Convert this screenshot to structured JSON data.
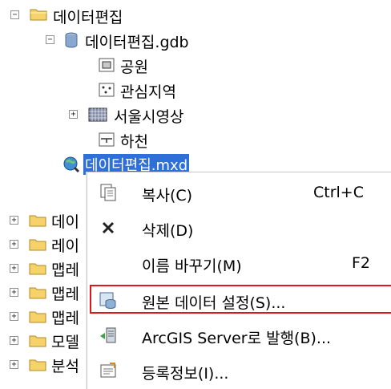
{
  "tree": {
    "root_label": "데이터편집",
    "gdb_label": "데이터편집.gdb",
    "children": [
      "공원",
      "관심지역",
      "서울시영상",
      "하천"
    ],
    "mxd_label": "데이터편집.mxd",
    "collapsed_partial": [
      "데이",
      "레이",
      "맵레",
      "맵레",
      "맵레",
      "모델",
      "분석"
    ]
  },
  "context_menu": {
    "items": [
      {
        "label": "복사(C)",
        "shortcut": "Ctrl+C",
        "icon": "copy-icon"
      },
      {
        "label": "삭제(D)",
        "shortcut": "",
        "icon": "delete-x-icon"
      },
      {
        "label": "이름 바꾸기(M)",
        "shortcut": "F2",
        "icon": ""
      },
      {
        "label": "원본 데이터 설정(S)...",
        "shortcut": "",
        "icon": "set-data-source-icon"
      },
      {
        "label": "ArcGIS Server로 발행(B)...",
        "shortcut": "",
        "icon": "publish-server-icon"
      },
      {
        "label": "등록정보(I)...",
        "shortcut": "",
        "icon": "properties-icon"
      }
    ]
  },
  "colors": {
    "selection": "#2f6fd8",
    "highlight_box": "#e0151c",
    "folder": "#f5d36a"
  }
}
